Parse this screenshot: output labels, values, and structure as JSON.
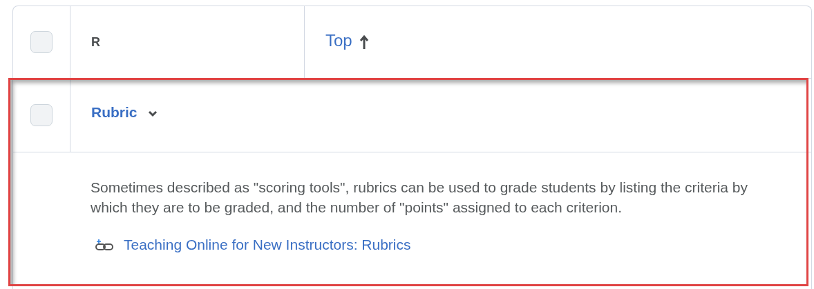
{
  "table": {
    "header": {
      "checked": false,
      "columns": [
        {
          "label": "R",
          "kind": "label"
        },
        {
          "label": "Top",
          "kind": "sort-link",
          "ascending": true
        }
      ]
    },
    "rows": [
      {
        "checked": false,
        "title": "Rubric",
        "expanded": true,
        "highlighted": true,
        "description": "Sometimes described as \"scoring tools\", rubrics can be used to grade students by listing the criteria by which they are to be graded, and the number of \"points\" assigned to each criterion.",
        "link": "Teaching Online for New Instructors: Rubrics"
      }
    ]
  }
}
